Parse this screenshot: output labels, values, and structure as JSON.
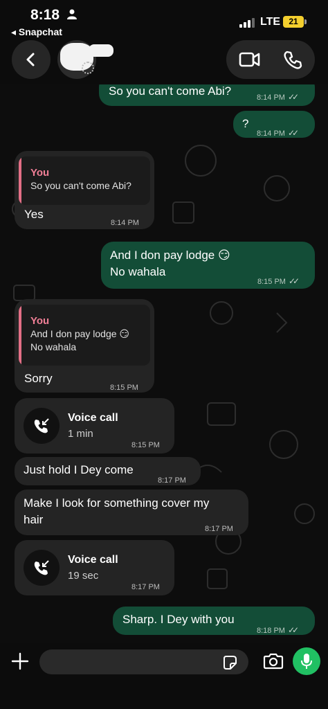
{
  "status": {
    "time": "8:18",
    "back_app": "Snapchat",
    "network": "LTE",
    "battery": "21"
  },
  "header": {
    "contact_name": "",
    "actions": [
      "video-call",
      "voice-call"
    ]
  },
  "messages": [
    {
      "dir": "out",
      "text": "So you can't come Abi?",
      "time": "8:14 PM"
    },
    {
      "dir": "out",
      "text": "?",
      "time": "8:14 PM"
    },
    {
      "dir": "in",
      "reply_to": {
        "author": "You",
        "text": "So you can't come Abi?"
      },
      "text": "Yes",
      "time": "8:14 PM"
    },
    {
      "dir": "out",
      "text": "And I don pay lodge 😏",
      "text2": "No wahala",
      "time": "8:15 PM"
    },
    {
      "dir": "in",
      "reply_to": {
        "author": "You",
        "text": "And I don pay lodge 😏",
        "text2": "No wahala"
      },
      "text": "Sorry",
      "time": "8:15 PM"
    },
    {
      "dir": "in",
      "call": true,
      "title": "Voice call",
      "duration": "1 min",
      "time": "8:15 PM"
    },
    {
      "dir": "in",
      "text": "Just hold I Dey come",
      "time": "8:17 PM"
    },
    {
      "dir": "in",
      "text": "Make I look for something cover my",
      "text2": "hair",
      "time": "8:17 PM"
    },
    {
      "dir": "in",
      "call": true,
      "title": "Voice call",
      "duration": "19 sec",
      "time": "8:17 PM"
    },
    {
      "dir": "out",
      "text": "Sharp. I Dey with you",
      "time": "8:18 PM"
    }
  ],
  "ticks": "✓✓",
  "composer": {
    "placeholder": ""
  },
  "colors": {
    "outgoing": "#134d37",
    "incoming": "#242424",
    "reply_accent": "#f07f96",
    "mic": "#21c063"
  }
}
